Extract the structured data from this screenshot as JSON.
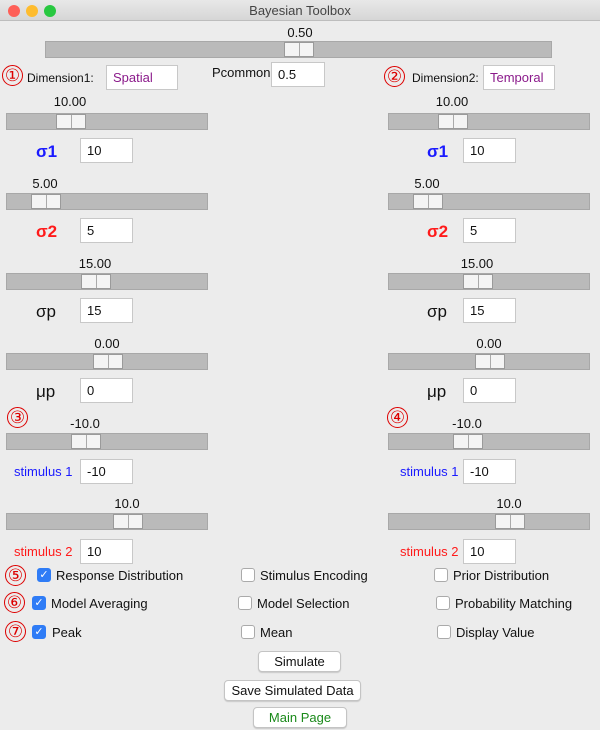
{
  "window": {
    "title": "Bayesian Toolbox"
  },
  "pcommon": {
    "slider_value": "0.50",
    "fraction": 0.5,
    "label": "Pcommon",
    "input": "0.5"
  },
  "markers": [
    "①",
    "②",
    "③",
    "④",
    "⑤",
    "⑥",
    "⑦"
  ],
  "dim1": {
    "label": "Dimension1:",
    "value": "Spatial"
  },
  "dim2": {
    "label": "Dimension2:",
    "value": "Temporal"
  },
  "colors": {
    "sigma1": "#1a1aff",
    "sigma2": "#ff1a1a",
    "dim_text": "#8b1a8b",
    "main_page": "#1a8a1a",
    "checkbox": "#2f7cf6"
  },
  "left": {
    "sigma1": {
      "slider": "10.00",
      "label": "σ1",
      "input": "10"
    },
    "sigma2": {
      "slider": "5.00",
      "label": "σ2",
      "input": "5"
    },
    "sigmap": {
      "slider": "15.00",
      "label": "σp",
      "input": "15"
    },
    "mup": {
      "slider": "0.00",
      "label": "μp",
      "input": "0"
    },
    "stim1": {
      "slider": "-10.0",
      "label": "stimulus 1",
      "input": "-10"
    },
    "stim2": {
      "slider": "10.0",
      "label": "stimulus 2",
      "input": "10"
    }
  },
  "right": {
    "sigma1": {
      "slider": "10.00",
      "label": "σ1",
      "input": "10"
    },
    "sigma2": {
      "slider": "5.00",
      "label": "σ2",
      "input": "5"
    },
    "sigmap": {
      "slider": "15.00",
      "label": "σp",
      "input": "15"
    },
    "mup": {
      "slider": "0.00",
      "label": "μp",
      "input": "0"
    },
    "stim1": {
      "slider": "-10.0",
      "label": "stimulus 1",
      "input": "-10"
    },
    "stim2": {
      "slider": "10.0",
      "label": "stimulus 2",
      "input": "10"
    }
  },
  "checkboxes": [
    [
      {
        "label": "Response Distribution",
        "checked": true
      },
      {
        "label": "Stimulus Encoding",
        "checked": false
      },
      {
        "label": "Prior Distribution",
        "checked": false
      }
    ],
    [
      {
        "label": "Model Averaging",
        "checked": true
      },
      {
        "label": "Model Selection",
        "checked": false
      },
      {
        "label": "Probability Matching",
        "checked": false
      }
    ],
    [
      {
        "label": "Peak",
        "checked": true
      },
      {
        "label": "Mean",
        "checked": false
      },
      {
        "label": "Display Value",
        "checked": false
      }
    ]
  ],
  "buttons": {
    "simulate": "Simulate",
    "save": "Save Simulated Data",
    "main_page": "Main Page"
  }
}
